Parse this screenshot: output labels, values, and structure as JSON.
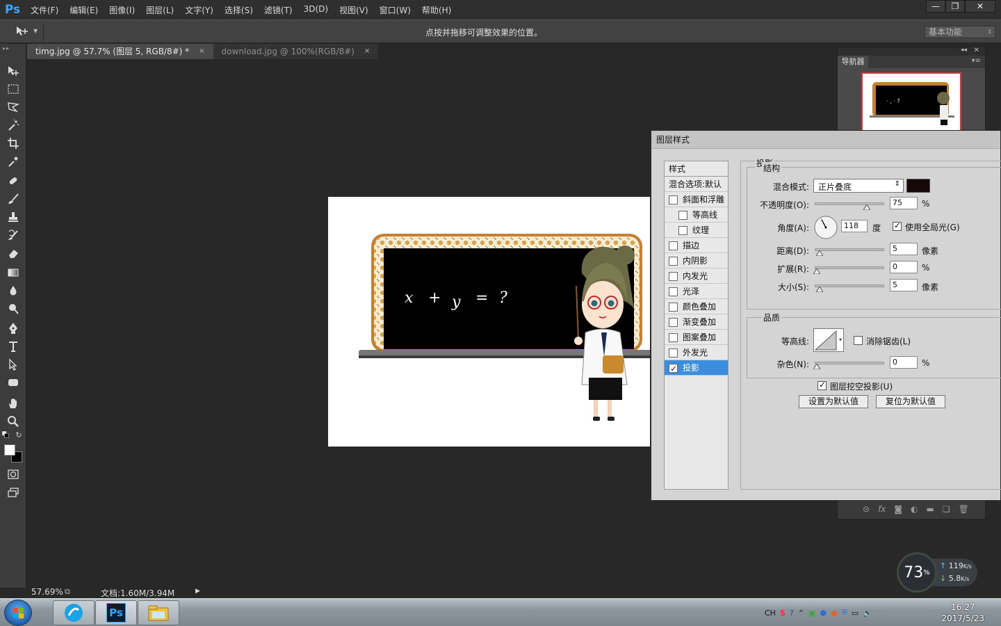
{
  "app": {
    "logo": "Ps",
    "menu": [
      "文件(F)",
      "编辑(E)",
      "图像(I)",
      "图层(L)",
      "文字(Y)",
      "选择(S)",
      "滤镜(T)",
      "3D(D)",
      "视图(V)",
      "窗口(W)",
      "帮助(H)"
    ],
    "window_controls": {
      "minimize": "—",
      "restore": "❐",
      "close": "✕"
    }
  },
  "options_bar": {
    "hint": "点按并拖移可调整效果的位置。",
    "workspace": "基本功能"
  },
  "tabs": [
    {
      "label": "timg.jpg @ 57.7% (图层 5, RGB/8#) *",
      "close": "×"
    },
    {
      "label": "download.jpg @ 100%(RGB/8#)",
      "close": "×"
    }
  ],
  "status": {
    "zoom": "57.69%",
    "doc_info": "文档:1.60M/3.94M",
    "arrow": "▶"
  },
  "canvas": {
    "equation": [
      "x",
      "+",
      "y",
      "=",
      "?"
    ]
  },
  "navigator": {
    "tab": "导航器",
    "collapse": "◂◂",
    "close": "✕",
    "menu": "▾≡"
  },
  "layer_style": {
    "title": "图层样式",
    "styles_header": "样式",
    "blend_options": "混合选项:默认",
    "items": [
      {
        "label": "斜面和浮雕",
        "checked": false,
        "indent": false
      },
      {
        "label": "等高线",
        "checked": false,
        "indent": true
      },
      {
        "label": "纹理",
        "checked": false,
        "indent": true
      },
      {
        "label": "描边",
        "checked": false,
        "indent": false
      },
      {
        "label": "内阴影",
        "checked": false,
        "indent": false
      },
      {
        "label": "内发光",
        "checked": false,
        "indent": false
      },
      {
        "label": "光泽",
        "checked": false,
        "indent": false
      },
      {
        "label": "颜色叠加",
        "checked": false,
        "indent": false
      },
      {
        "label": "渐变叠加",
        "checked": false,
        "indent": false
      },
      {
        "label": "图案叠加",
        "checked": false,
        "indent": false
      },
      {
        "label": "外发光",
        "checked": false,
        "indent": false
      },
      {
        "label": "投影",
        "checked": true,
        "indent": false,
        "selected": true
      }
    ],
    "section_title": "投影",
    "structure": {
      "title": "结构",
      "blend_mode_label": "混合模式:",
      "blend_mode_value": "正片叠底",
      "shadow_color": "#150808",
      "opacity_label": "不透明度(O):",
      "opacity_value": "75",
      "opacity_unit": "%",
      "angle_label": "角度(A):",
      "angle_value": "118",
      "angle_unit": "度",
      "global_light_label": "使用全局光(G)",
      "global_light_checked": true,
      "distance_label": "距离(D):",
      "distance_value": "5",
      "distance_unit": "像素",
      "spread_label": "扩展(R):",
      "spread_value": "0",
      "spread_unit": "%",
      "size_label": "大小(S):",
      "size_value": "5",
      "size_unit": "像素"
    },
    "quality": {
      "title": "品质",
      "contour_label": "等高线:",
      "antialias_label": "消除锯齿(L)",
      "antialias_checked": false,
      "noise_label": "杂色(N):",
      "noise_value": "0",
      "noise_unit": "%"
    },
    "knockout_label": "图层挖空投影(U)",
    "knockout_checked": true,
    "set_default": "设置为默认值",
    "reset_default": "复位为默认值"
  },
  "net_widget": {
    "percent": "73",
    "percent_sign": "%",
    "up": "119",
    "up_unit": "K/s",
    "down": "5.8",
    "down_unit": "K/s"
  },
  "taskbar": {
    "lang": "CH",
    "time": "16:27",
    "date": "2017/5/23"
  }
}
